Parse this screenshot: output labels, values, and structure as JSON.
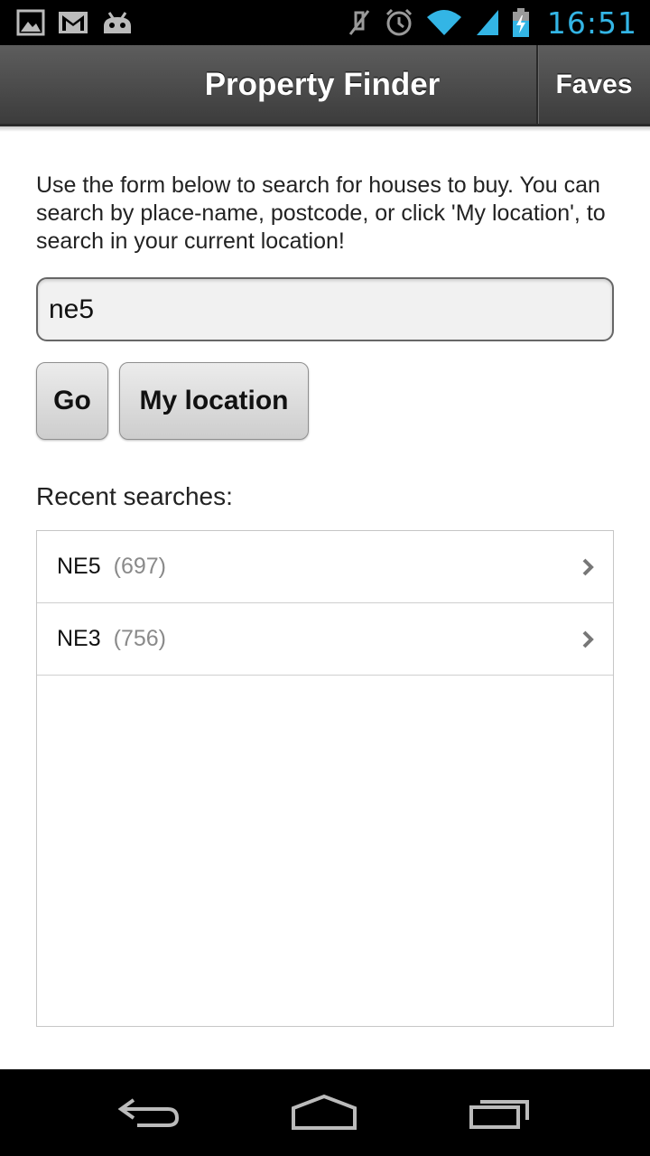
{
  "status_bar": {
    "time": "16:51",
    "left_icons": [
      "gallery-icon",
      "gmail-icon",
      "android-debug-icon"
    ],
    "right_icons": [
      "muted-icon",
      "alarm-icon",
      "wifi-icon",
      "signal-icon",
      "battery-charging-icon"
    ],
    "time_color": "#33b5e5"
  },
  "header": {
    "title": "Property Finder",
    "faves_label": "Faves"
  },
  "main": {
    "intro": "Use the form below to search for houses to buy.  You can search by place-name, postcode, or click 'My location', to search in your current location!",
    "search_value": "ne5",
    "go_label": "Go",
    "location_label": "My location",
    "recent_heading": "Recent searches:",
    "recent_searches": [
      {
        "code": "NE5",
        "count": "(697)"
      },
      {
        "code": "NE3",
        "count": "(756)"
      }
    ]
  },
  "nav_bar": {
    "icons": [
      "back-icon",
      "home-icon",
      "recent-apps-icon"
    ]
  }
}
